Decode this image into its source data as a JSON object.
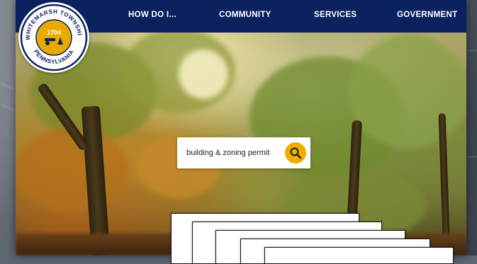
{
  "seal": {
    "arc_top": "WHITEMARSH TOWNSHIP",
    "arc_bottom": "PENNSYLVANIA",
    "year": "1704"
  },
  "nav": {
    "items": [
      {
        "label": "HOW DO I..."
      },
      {
        "label": "COMMUNITY"
      },
      {
        "label": "SERVICES"
      },
      {
        "label": "GOVERNMENT"
      }
    ]
  },
  "search": {
    "value": "building & zoning permit",
    "icon": "search-icon"
  },
  "colors": {
    "nav_bg": "#0b2260",
    "accent": "#f0ad00"
  }
}
